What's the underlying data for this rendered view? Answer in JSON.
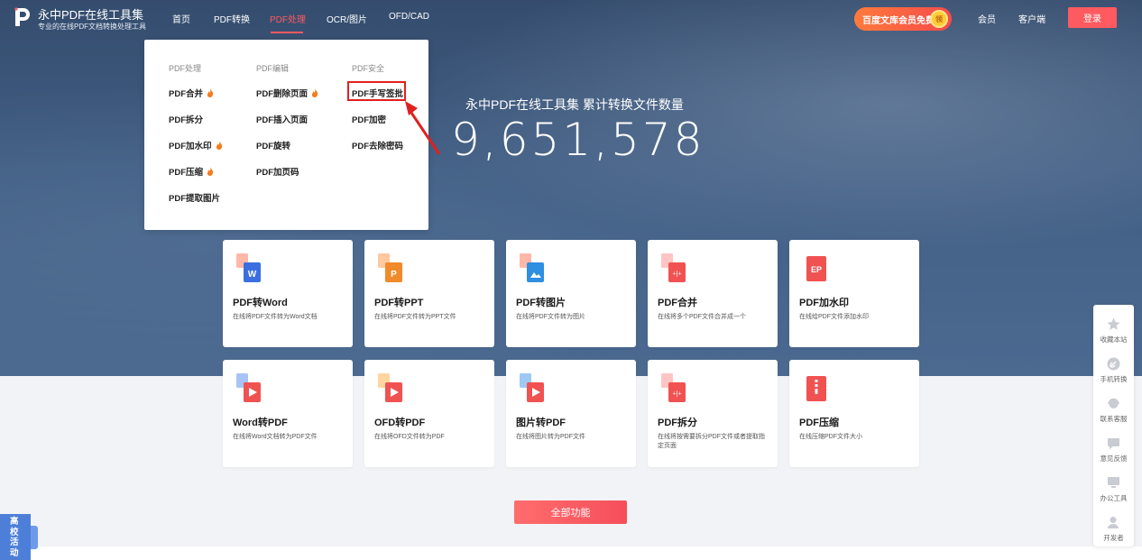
{
  "header": {
    "brand_title": "永中PDF在线工具集",
    "brand_subtitle": "专业的在线PDF文档转换处理工具",
    "nav": [
      "首页",
      "PDF转换",
      "PDF处理",
      "OCR/图片",
      "OFD/CAD"
    ],
    "active_nav": "PDF处理",
    "promo_label": "百度文库会员免费",
    "promo_badge": "领",
    "member_label": "会员",
    "client_label": "客户端",
    "login_label": "登录"
  },
  "stats": {
    "title": "永中PDF在线工具集  累计转换文件数量",
    "count": "9,651,578"
  },
  "dropdown": {
    "columns": [
      {
        "heading": "PDF处理",
        "items": [
          {
            "label": "PDF合并",
            "hot": true
          },
          {
            "label": "PDF拆分",
            "hot": false
          },
          {
            "label": "PDF加水印",
            "hot": true
          },
          {
            "label": "PDF压缩",
            "hot": true
          },
          {
            "label": "PDF提取图片",
            "hot": false
          }
        ]
      },
      {
        "heading": "PDF编辑",
        "items": [
          {
            "label": "PDF删除页面",
            "hot": true
          },
          {
            "label": "PDF插入页面",
            "hot": false
          },
          {
            "label": "PDF旋转",
            "hot": false
          },
          {
            "label": "PDF加页码",
            "hot": false
          }
        ]
      },
      {
        "heading": "PDF安全",
        "items": [
          {
            "label": "PDF手写签批",
            "hot": false,
            "highlighted": true
          },
          {
            "label": "PDF加密",
            "hot": false
          },
          {
            "label": "PDF去除密码",
            "hot": false
          }
        ]
      }
    ]
  },
  "cards": [
    {
      "title": "PDF转Word",
      "desc": "在线将PDF文件转为Word文档",
      "icon": "pdf-to-word-icon",
      "color": "#3b6fe0"
    },
    {
      "title": "PDF转PPT",
      "desc": "在线将PDF文件转为PPT文件",
      "icon": "pdf-to-ppt-icon",
      "color": "#f08a2a"
    },
    {
      "title": "PDF转图片",
      "desc": "在线将PDF文件转为图片",
      "icon": "pdf-to-image-icon",
      "color": "#2f8fe0"
    },
    {
      "title": "PDF合并",
      "desc": "在线将多个PDF文件合并成一个",
      "icon": "pdf-merge-icon",
      "color": "#f05252"
    },
    {
      "title": "PDF加水印",
      "desc": "在线给PDF文件添加水印",
      "icon": "pdf-watermark-icon",
      "color": "#f05252"
    },
    {
      "title": "Word转PDF",
      "desc": "在线将Word文档转为PDF文件",
      "icon": "word-to-pdf-icon",
      "color": "#f05252"
    },
    {
      "title": "OFD转PDF",
      "desc": "在线将OFD文件转为PDF",
      "icon": "ofd-to-pdf-icon",
      "color": "#f05252"
    },
    {
      "title": "图片转PDF",
      "desc": "在线将图片转为PDF文件",
      "icon": "image-to-pdf-icon",
      "color": "#f05252"
    },
    {
      "title": "PDF拆分",
      "desc": "在线将按需要拆分PDF文件或者提取指定页面",
      "icon": "pdf-split-icon",
      "color": "#f05252"
    },
    {
      "title": "PDF压缩",
      "desc": "在线压缩PDF文件大小",
      "icon": "pdf-compress-icon",
      "color": "#f05252"
    }
  ],
  "all_features_label": "全部功能",
  "sidebar": [
    {
      "label": "收藏本站",
      "icon": "star-icon"
    },
    {
      "label": "手机转换",
      "icon": "link-icon"
    },
    {
      "label": "联系客服",
      "icon": "headset-icon"
    },
    {
      "label": "意见反馈",
      "icon": "feedback-icon"
    },
    {
      "label": "办公工具",
      "icon": "monitor-icon"
    },
    {
      "label": "开发者",
      "icon": "developer-icon"
    }
  ],
  "campus_label": "高校活动",
  "colors": {
    "accent": "#ff5a5f",
    "highlight": "#e02020",
    "campus": "#4e7fd8"
  }
}
